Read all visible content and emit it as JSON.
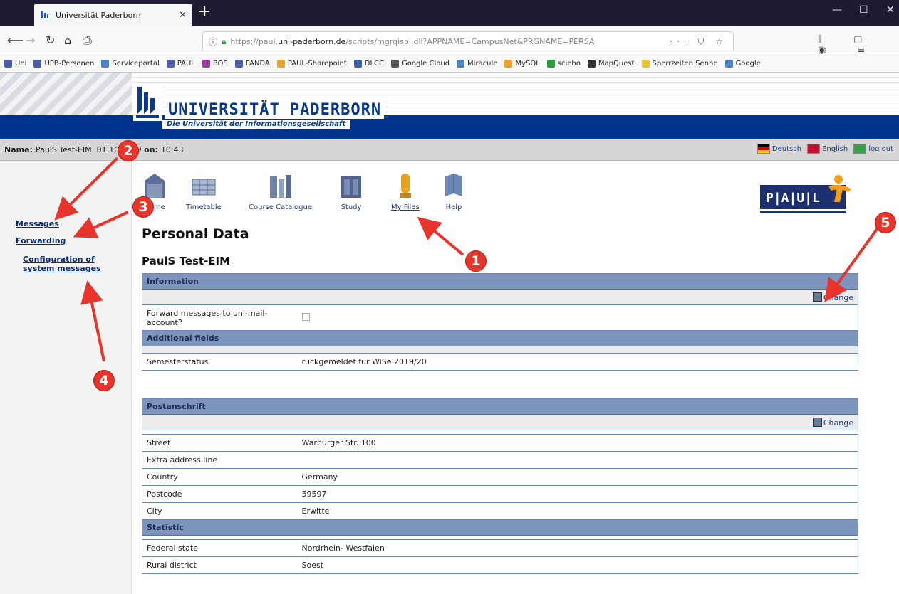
{
  "browser": {
    "tab_title": "Universität Paderborn",
    "url_prefix": "https://paul.",
    "url_host": "uni-paderborn.de",
    "url_rest": "/scripts/mgrqispi.dll?APPNAME=CampusNet&PRGNAME=PERSA"
  },
  "bookmarks": [
    {
      "label": "Uni",
      "color": "#4b5fa8"
    },
    {
      "label": "UPB-Personen",
      "color": "#4b5fa8"
    },
    {
      "label": "Serviceportal",
      "color": "#4b82c4"
    },
    {
      "label": "PAUL",
      "color": "#4b5fa8"
    },
    {
      "label": "BOS",
      "color": "#9b3ba8"
    },
    {
      "label": "PANDA",
      "color": "#4b5fa8"
    },
    {
      "label": "PAUL-Sharepoint",
      "color": "#e8a42a"
    },
    {
      "label": "DLCC",
      "color": "#3a5faa"
    },
    {
      "label": "Google Cloud",
      "color": "#555555"
    },
    {
      "label": "Miracule",
      "color": "#4b82c4"
    },
    {
      "label": "MySQL",
      "color": "#e8a42a"
    },
    {
      "label": "sciebo",
      "color": "#2a9e3a"
    },
    {
      "label": "MapQuest",
      "color": "#333333"
    },
    {
      "label": "Sperrzeiten Senne",
      "color": "#e8c42a"
    },
    {
      "label": "Google",
      "color": "#4b82c4"
    }
  ],
  "header": {
    "uni_name": "UNIVERSITÄT PADERBORN",
    "uni_subtitle": "Die Universität der Informationsgesellschaft"
  },
  "status": {
    "name_label": "Name:",
    "name_value": "PaulS Test-EIM",
    "date_value": "01.10.2019",
    "on_label": "on:",
    "time_value": "10:43",
    "lang_de": "Deutsch",
    "lang_en": "English",
    "logout": "log out"
  },
  "leftnav": {
    "messages": "Messages",
    "forwarding": "Forwarding",
    "config_line1": "Configuration of",
    "config_line2": "system messages"
  },
  "toolbar": [
    {
      "label": "Home",
      "color": "#5b6e9a"
    },
    {
      "label": "Timetable",
      "color": "#8fa4c6"
    },
    {
      "label": "Course Catalogue",
      "color": "#6f82a8"
    },
    {
      "label": "Study",
      "color": "#4f638f"
    },
    {
      "label": "My Files",
      "color": "#e6a320"
    },
    {
      "label": "Help",
      "color": "#6c86b5"
    }
  ],
  "paul_logo": "P|A|U|L",
  "main": {
    "page_title": "Personal Data",
    "person_name": "PaulS Test-EIM",
    "change_label": "Change",
    "information": {
      "header": "Information",
      "forward_label": "Forward messages to uni-mail-account?"
    },
    "additional": {
      "header": "Additional fields",
      "rows": [
        {
          "label": "Semesterstatus",
          "value": "rückgemeldet für WiSe 2019/20"
        }
      ]
    },
    "postanschrift": {
      "header": "Postanschrift",
      "rows": [
        {
          "label": "Street",
          "value": "Warburger Str. 100"
        },
        {
          "label": "Extra address line",
          "value": ""
        },
        {
          "label": "Country",
          "value": "Germany"
        },
        {
          "label": "Postcode",
          "value": "59597"
        },
        {
          "label": "City",
          "value": "Erwitte"
        }
      ]
    },
    "statistic": {
      "header": "Statistic",
      "rows": [
        {
          "label": "Federal state",
          "value": "Nordrhein- Westfalen"
        },
        {
          "label": "Rural district",
          "value": "Soest"
        }
      ]
    }
  },
  "markers": [
    "1",
    "2",
    "3",
    "4",
    "5"
  ]
}
